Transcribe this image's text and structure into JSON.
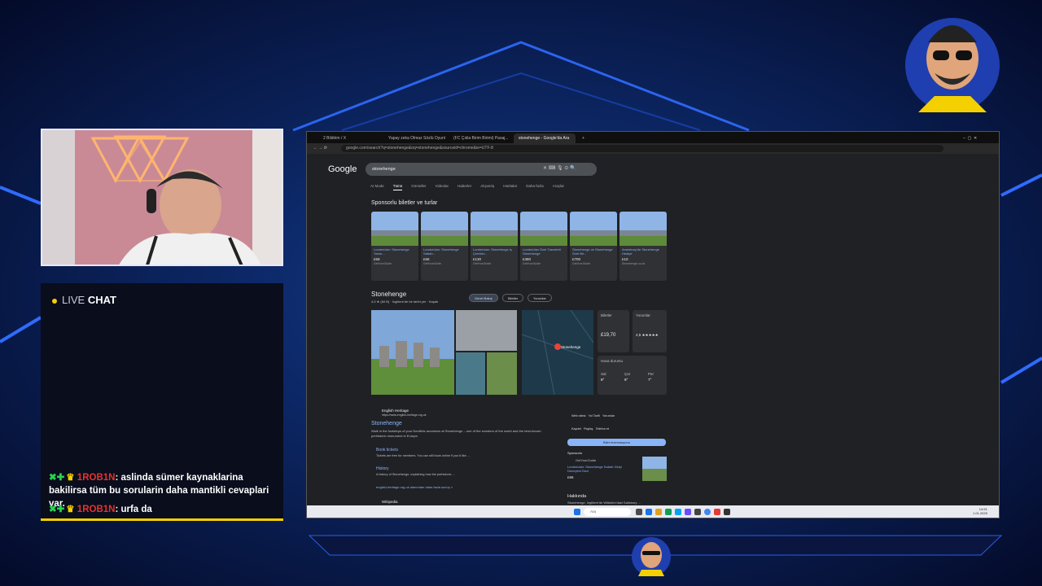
{
  "chat": {
    "live_word": "LIVE",
    "chat_word": "CHAT",
    "messages": [
      {
        "user": "1ROB1N",
        "text": ": aslinda sümer kaynaklarina bakilirsa tüm bu sorularin daha mantikli cevaplari var."
      },
      {
        "user": "1ROB1N",
        "text": ": urfa da"
      }
    ]
  },
  "browser": {
    "tabs": [
      "2 Bildirim / X",
      "Yapay zeka Olmaz Sözlü Oyunl...",
      "(FC Çıkla Birim Birimi) Pasaj...",
      "stonehenge - Google'da Ara"
    ],
    "url": "google.com/search?q=stonehenge&oq=stonehenge&sourceid=chrome&ie=UTF-8",
    "google_logo": "Google",
    "query": "stonehenge",
    "search_tabs": [
      "AI Mode",
      "Tümü",
      "Görseller",
      "Videolar",
      "Haberler",
      "Alışveriş",
      "Haritalar",
      "Daha fazla",
      "Araçlar"
    ],
    "sponsored_title": "Sponsorlu biletler ve turlar",
    "products": [
      {
        "title": "Londra'dan: Stonehenge Yarım...",
        "price": "£59",
        "seller": "GetYourGuide"
      },
      {
        "title": "Londra'dan: Stonehenge Sabah...",
        "price": "£66",
        "seller": "GetYourGuide"
      },
      {
        "title": "Londra'dan: Stonehenge İç Çember...",
        "price": "£130",
        "seller": "GetYourGuide"
      },
      {
        "title": "Londra'dan Özel Transferli Stonehenge",
        "price": "£380",
        "seller": "GetYourGuide"
      },
      {
        "title": "Stonehenge ve Stonehenge Özel Bir...",
        "price": "£700",
        "seller": "GetYourGuide"
      },
      {
        "title": "Amesbury'de Stonehenge Hediye",
        "price": "£10",
        "seller": "Stonehenge.co.uk"
      }
    ],
    "kp_title": "Stonehenge",
    "kp_rating": "4,5 ★ (84 B) · İngiltere'de bir tarihi yer · Kapalı",
    "chips": [
      "Genel Bakış",
      "Biletler",
      "Yorumlar"
    ],
    "map_label": "Stonehenge",
    "tickets_label": "Biletler",
    "tickets_price": "£19,70",
    "reviews_label": "Yorumlar",
    "reviews_score": "4,5 ★★★★★",
    "weather_label": "Hava durumu",
    "weather_days": [
      {
        "day": "Sal",
        "temp": "9°"
      },
      {
        "day": "Çar",
        "temp": "9°"
      },
      {
        "day": "Per",
        "temp": "7°"
      }
    ],
    "result_site": "English Heritage",
    "result_url": "https://www.english-heritage.org.uk",
    "result_title": "Stonehenge",
    "result_snippet": "Walk in the footsteps of your Neolithic ancestors at Stonehenge – one of the wonders of the world and the best-known prehistoric monument in Europe.",
    "sublinks": [
      {
        "title": "Book tickets",
        "desc": "Tickets are free for members. You can still book online if you'd like ..."
      },
      {
        "title": "History",
        "desc": "A history of Stonehenge, explaining how the prehistoric ..."
      }
    ],
    "more_link": "english-heritage.org.uk alanından daha fazla sonuç »",
    "second_site": "Wikipedia",
    "actions": [
      "Web sitesi",
      "Yol Tarifi",
      "Yorumlar",
      "Kaydet",
      "Paylaş",
      "Telefon et"
    ],
    "book_button": "Bilet rezervasyonu",
    "sponsored_label": "Sponsorlu",
    "sponsor_name": "GetYourGuide",
    "sponsor_title": "Londra'dan: Stonehenge Sabah Girişi Deneyimi Gezi",
    "sponsor_price": "£66",
    "about_label": "Hakkında",
    "about_text": "Stonehenge, İngiltere'de Wiltshire'daki Salisbury ..."
  },
  "taskbar": {
    "search_placeholder": "Ara",
    "time": "14:51",
    "date": "1.01.2025"
  },
  "colors": {
    "accent": "#f5d000",
    "chat_user": "#e5332f",
    "chat_icon": "#25d44c",
    "link": "#8ab4f8"
  }
}
